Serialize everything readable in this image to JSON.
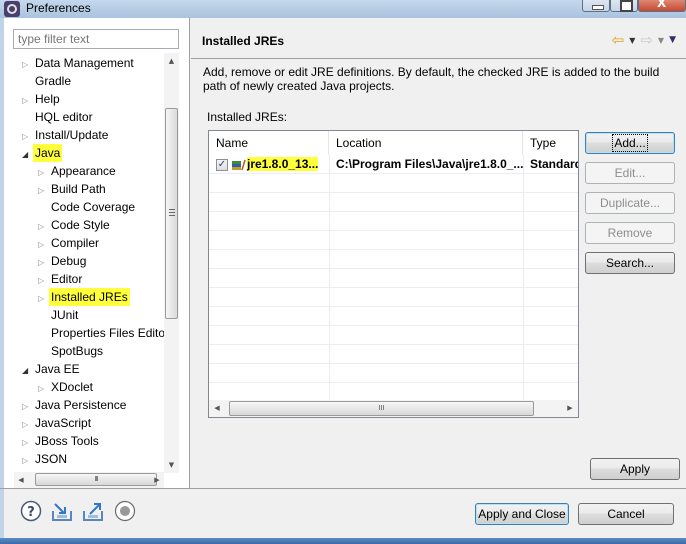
{
  "window": {
    "title": "Preferences",
    "controls": [
      "minimize",
      "maximize",
      "close"
    ]
  },
  "sidebar": {
    "filter_placeholder": "type filter text",
    "tree": [
      {
        "label": "Data Management",
        "level": 0,
        "expander": "collapsed"
      },
      {
        "label": "Gradle",
        "level": 0,
        "expander": "none"
      },
      {
        "label": "Help",
        "level": 0,
        "expander": "collapsed"
      },
      {
        "label": "HQL editor",
        "level": 0,
        "expander": "none"
      },
      {
        "label": "Install/Update",
        "level": 0,
        "expander": "collapsed"
      },
      {
        "label": "Java",
        "level": 0,
        "expander": "expanded",
        "highlighted": true
      },
      {
        "label": "Appearance",
        "level": 1,
        "expander": "collapsed"
      },
      {
        "label": "Build Path",
        "level": 1,
        "expander": "collapsed"
      },
      {
        "label": "Code Coverage",
        "level": 1,
        "expander": "none"
      },
      {
        "label": "Code Style",
        "level": 1,
        "expander": "collapsed"
      },
      {
        "label": "Compiler",
        "level": 1,
        "expander": "collapsed"
      },
      {
        "label": "Debug",
        "level": 1,
        "expander": "collapsed"
      },
      {
        "label": "Editor",
        "level": 1,
        "expander": "collapsed"
      },
      {
        "label": "Installed JREs",
        "level": 1,
        "expander": "collapsed",
        "highlighted": true,
        "selected": true
      },
      {
        "label": "JUnit",
        "level": 1,
        "expander": "none"
      },
      {
        "label": "Properties Files Editor",
        "level": 1,
        "expander": "none"
      },
      {
        "label": "SpotBugs",
        "level": 1,
        "expander": "none"
      },
      {
        "label": "Java EE",
        "level": 0,
        "expander": "expanded"
      },
      {
        "label": "XDoclet",
        "level": 1,
        "expander": "collapsed"
      },
      {
        "label": "Java Persistence",
        "level": 0,
        "expander": "collapsed"
      },
      {
        "label": "JavaScript",
        "level": 0,
        "expander": "collapsed"
      },
      {
        "label": "JBoss Tools",
        "level": 0,
        "expander": "collapsed"
      },
      {
        "label": "JSON",
        "level": 0,
        "expander": "collapsed"
      }
    ]
  },
  "page": {
    "title": "Installed JREs",
    "nav": {
      "back": "back-arrow",
      "forward": "forward-arrow",
      "menu": "view-menu"
    },
    "description": "Add, remove or edit JRE definitions. By default, the checked JRE is added to the build path of newly created Java projects.",
    "table_label": "Installed JREs:",
    "table": {
      "columns": [
        "Name",
        "Location",
        "Type"
      ],
      "rows": [
        {
          "checked": true,
          "name": "jre1.8.0_13...",
          "location": "C:\\Program Files\\Java\\jre1.8.0_...",
          "type": "Standard"
        }
      ]
    },
    "buttons": {
      "add": "Add...",
      "edit": "Edit...",
      "duplicate": "Duplicate...",
      "remove": "Remove",
      "search": "Search..."
    },
    "apply": "Apply"
  },
  "footer": {
    "icons": [
      "help-icon",
      "import-icon",
      "export-icon",
      "record-icon"
    ],
    "apply_and_close": "Apply and Close",
    "cancel": "Cancel"
  },
  "colors": {
    "highlight": "#ffff3c",
    "default_button_border": "#3c7fb1"
  }
}
